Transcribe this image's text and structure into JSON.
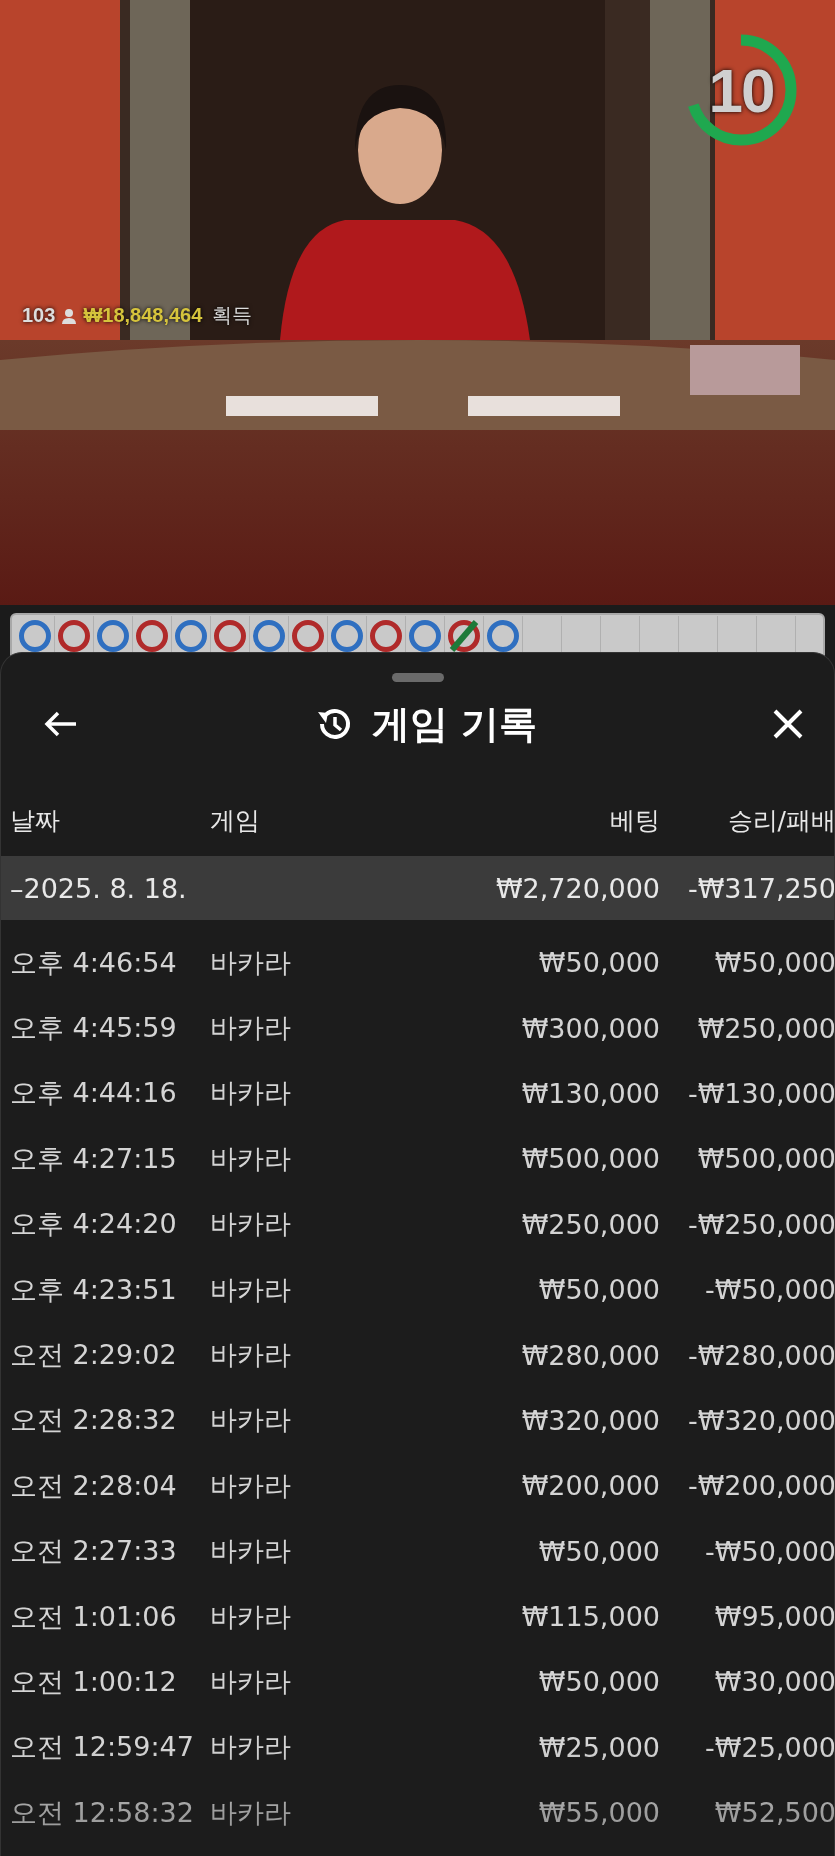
{
  "video": {
    "kind": "picture",
    "timer": {
      "count": "10",
      "level": 0.7
    },
    "players": "103",
    "winnings": "₩18,848,464",
    "winnings_label": "획득"
  },
  "road": {
    "results": [
      {
        "color": "#2f6fc0",
        "tie": false
      },
      {
        "color": "#b02a2a",
        "tie": false
      },
      {
        "color": "#2f6fc0",
        "tie": false
      },
      {
        "color": "#b02a2a",
        "tie": false
      },
      {
        "color": "#2f6fc0",
        "tie": false
      },
      {
        "color": "#b02a2a",
        "tie": false
      },
      {
        "color": "#2f6fc0",
        "tie": false
      },
      {
        "color": "#b02a2a",
        "tie": false
      },
      {
        "color": "#2f6fc0",
        "tie": false
      },
      {
        "color": "#b02a2a",
        "tie": false
      },
      {
        "color": "#2f6fc0",
        "tie": false
      },
      {
        "color": "#b02a2a",
        "tie": true
      },
      {
        "color": "#2f6fc0",
        "tie": false
      }
    ]
  },
  "sheet": {
    "title": "게임 기록",
    "columns": [
      "날짜",
      "게임",
      "베팅",
      "승리/패배"
    ],
    "date_group": {
      "toggle": "–",
      "date": "2025. 8. 18.",
      "bet": "₩2,720,000",
      "result": "-₩317,250",
      "expanded": true
    },
    "rows": [
      {
        "time": "오후 4:46:54",
        "game": "바카라",
        "bet": "₩50,000",
        "result": "₩50,000"
      },
      {
        "time": "오후 4:45:59",
        "game": "바카라",
        "bet": "₩300,000",
        "result": "₩250,000"
      },
      {
        "time": "오후 4:44:16",
        "game": "바카라",
        "bet": "₩130,000",
        "result": "-₩130,000"
      },
      {
        "time": "오후 4:27:15",
        "game": "바카라",
        "bet": "₩500,000",
        "result": "₩500,000"
      },
      {
        "time": "오후 4:24:20",
        "game": "바카라",
        "bet": "₩250,000",
        "result": "-₩250,000"
      },
      {
        "time": "오후 4:23:51",
        "game": "바카라",
        "bet": "₩50,000",
        "result": "-₩50,000"
      },
      {
        "time": "오전 2:29:02",
        "game": "바카라",
        "bet": "₩280,000",
        "result": "-₩280,000"
      },
      {
        "time": "오전 2:28:32",
        "game": "바카라",
        "bet": "₩320,000",
        "result": "-₩320,000"
      },
      {
        "time": "오전 2:28:04",
        "game": "바카라",
        "bet": "₩200,000",
        "result": "-₩200,000"
      },
      {
        "time": "오전 2:27:33",
        "game": "바카라",
        "bet": "₩50,000",
        "result": "-₩50,000"
      },
      {
        "time": "오전 1:01:06",
        "game": "바카라",
        "bet": "₩115,000",
        "result": "₩95,000"
      },
      {
        "time": "오전 1:00:12",
        "game": "바카라",
        "bet": "₩50,000",
        "result": "₩30,000"
      },
      {
        "time": "오전 12:59:47",
        "game": "바카라",
        "bet": "₩25,000",
        "result": "-₩25,000"
      },
      {
        "time": "오전 12:58:32",
        "game": "바카라",
        "bet": "₩55,000",
        "result": "₩52,500"
      }
    ]
  }
}
